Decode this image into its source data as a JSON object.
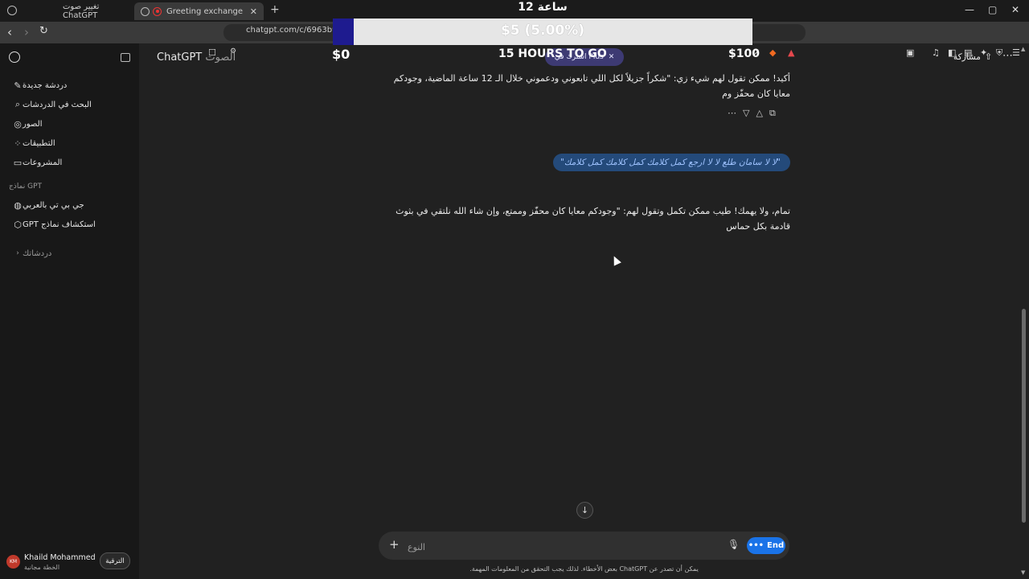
{
  "browser": {
    "tabs": [
      {
        "title": "تغيير صوت ChatGPT",
        "active": false
      },
      {
        "title": "Greeting exchange",
        "active": true
      }
    ],
    "url": "chatgpt.com/c/6963b9ee-"
  },
  "overlay": {
    "title": "12 ساعة",
    "amount": "$5 (5.00%)",
    "progress": 0.05,
    "min": "$0",
    "max": "$100",
    "remaining": "15 HOURS TO GO",
    "colors": {
      "fill": "#1e1b8f",
      "track": "#e6e6e6"
    }
  },
  "sidebar": {
    "items": [
      {
        "label": "دردشة جديدة",
        "icon": "edit-icon"
      },
      {
        "label": "البحث في الدردشات",
        "icon": "search-icon"
      },
      {
        "label": "الصور",
        "icon": "image-icon"
      },
      {
        "label": "التطبيقات",
        "icon": "apps-icon"
      },
      {
        "label": "المشروعات",
        "icon": "folder-icon"
      }
    ],
    "gpts_heading": "نماذج GPT",
    "gpts": [
      {
        "label": "جي بي تي بالعربي",
        "icon": "gpt-avatar-icon"
      },
      {
        "label": "استكشاف نماذج GPT",
        "icon": "cube-icon"
      }
    ],
    "chats_heading": "دردشاتك",
    "user": {
      "initials": "KM",
      "name": "Khaild Mohammed",
      "plan": "الخطة مجانية"
    },
    "upgrade_label": "الترقية"
  },
  "header": {
    "model": "ChatGPT",
    "model_suffix": "الصوت",
    "plus_pill": "اشترك في Plus",
    "share_label": "مشاركة"
  },
  "messages": [
    {
      "role": "assistant",
      "text": "أكيد! ممكن تقول لهم شيء زي: \"شكراً جزيلاً لكل اللي تابعوني ودعموني خلال الـ 12 ساعة الماضية، وجودكم معايا كان محفّز وم"
    },
    {
      "role": "user",
      "text": "\"لا لا سامان طلع لا لا ارجع كمل كلامك كمل كلامك كمل كلامك\""
    },
    {
      "role": "assistant",
      "text": "تمام، ولا يهمك! طيب ممكن تكمل وتقول لهم: \"وجودكم معايا كان محفّز وممتع، وإن شاء الله نلتقي في بثوث قادمة بكل حماس"
    }
  ],
  "composer": {
    "placeholder": "النوع",
    "end_label": "End",
    "disclaimer": "يمكن أن تصدر عن ChatGPT بعض الأخطاء. لذلك يجب التحقق من المعلومات المهمة."
  }
}
